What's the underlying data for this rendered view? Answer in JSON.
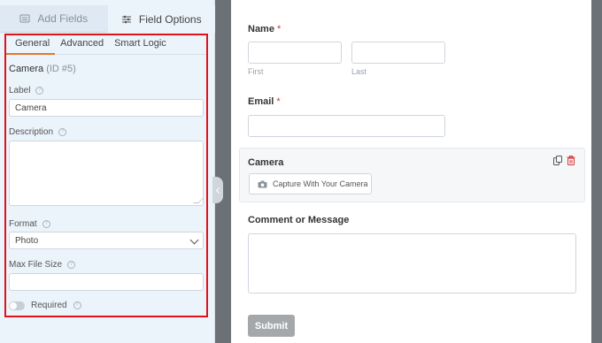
{
  "sidebar": {
    "tabs": [
      {
        "label": "Add Fields",
        "icon": "list-icon",
        "active": false
      },
      {
        "label": "Field Options",
        "icon": "sliders-icon",
        "active": true
      }
    ],
    "sub_tabs": [
      "General",
      "Advanced",
      "Smart Logic"
    ],
    "field": {
      "name": "Camera",
      "id_text": "(ID #5)"
    },
    "label": {
      "title": "Label",
      "value": "Camera"
    },
    "description": {
      "title": "Description",
      "value": ""
    },
    "format": {
      "title": "Format",
      "selected": "Photo"
    },
    "max_file_size": {
      "title": "Max File Size",
      "value": ""
    },
    "required": {
      "label": "Required",
      "on": false
    }
  },
  "preview": {
    "name": {
      "label": "Name",
      "required_mark": "*",
      "first_sub": "First",
      "last_sub": "Last"
    },
    "email": {
      "label": "Email",
      "required_mark": "*"
    },
    "camera": {
      "label": "Camera",
      "button_label": "Capture With Your Camera"
    },
    "comment": {
      "label": "Comment or Message"
    },
    "submit_label": "Submit"
  },
  "colors": {
    "highlight_border": "#e0131a",
    "active_tab_underline": "#e27730",
    "required_mark": "#d63638",
    "delete_icon": "#d63638",
    "submit_bg": "#a5a8ab"
  }
}
